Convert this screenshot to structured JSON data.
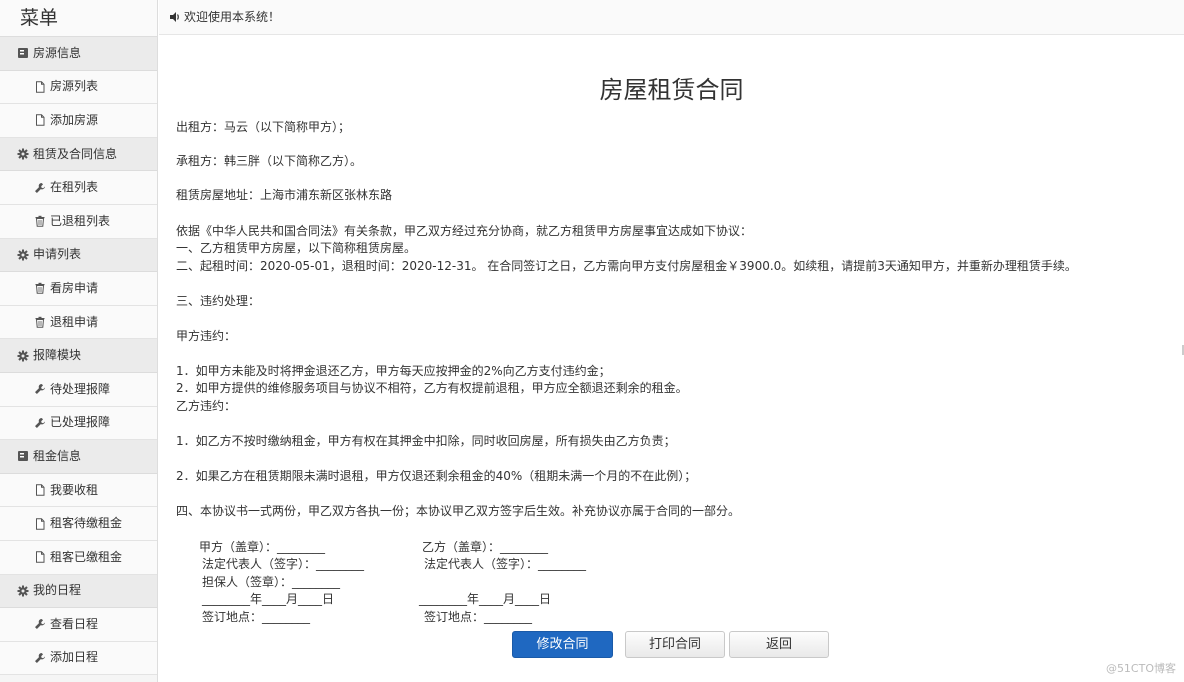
{
  "sidebar": {
    "title": "菜单",
    "groups": [
      {
        "label": "房源信息",
        "icon": "book-icon",
        "items": [
          {
            "label": "房源列表",
            "icon": "file-icon"
          },
          {
            "label": "添加房源",
            "icon": "file-icon"
          }
        ]
      },
      {
        "label": "租赁及合同信息",
        "icon": "gear-icon",
        "items": [
          {
            "label": "在租列表",
            "icon": "wrench-icon"
          },
          {
            "label": "已退租列表",
            "icon": "trash-icon"
          }
        ]
      },
      {
        "label": "申请列表",
        "icon": "gear-icon",
        "items": [
          {
            "label": "看房申请",
            "icon": "trash-icon"
          },
          {
            "label": "退租申请",
            "icon": "trash-icon"
          }
        ]
      },
      {
        "label": "报障模块",
        "icon": "gear-icon",
        "items": [
          {
            "label": "待处理报障",
            "icon": "wrench-icon"
          },
          {
            "label": "已处理报障",
            "icon": "wrench-icon"
          }
        ]
      },
      {
        "label": "租金信息",
        "icon": "book-icon",
        "items": [
          {
            "label": "我要收租",
            "icon": "file-icon"
          },
          {
            "label": "租客待缴租金",
            "icon": "file-icon"
          },
          {
            "label": "租客已缴租金",
            "icon": "file-icon"
          }
        ]
      },
      {
        "label": "我的日程",
        "icon": "gear-icon",
        "items": [
          {
            "label": "查看日程",
            "icon": "wrench-icon"
          },
          {
            "label": "添加日程",
            "icon": "wrench-icon"
          }
        ]
      }
    ]
  },
  "topbar": {
    "welcome": "欢迎使用本系统！",
    "icon": "volume-icon"
  },
  "contract": {
    "title": "房屋租赁合同",
    "lessor": "出租方：马云（以下简称甲方）；",
    "lessee": "承租方：韩三胖（以下简称乙方）。",
    "address": "租赁房屋地址：上海市浦东新区张林东路",
    "intro": "依据《中华人民共和国合同法》有关条款，甲乙双方经过充分协商，就乙方租赁甲方房屋事宜达成如下协议：",
    "clause1": "一、乙方租赁甲方房屋，以下简称租赁房屋。",
    "clause2": "二、起租时间：2020-05-01，退租时间：2020-12-31。 在合同签订之日，乙方需向甲方支付房屋租金￥3900.0。如续租，请提前3天通知甲方，并重新办理租赁手续。",
    "clause3": "三、违约处理：",
    "partyA_breach": "甲方违约：",
    "a1": "1．如甲方未能及时将押金退还乙方，甲方每天应按押金的2%向乙方支付违约金；",
    "a2": "2．如甲方提供的维修服务项目与协议不相符，乙方有权提前退租，甲方应全额退还剩余的租金。",
    "partyB_breach": "乙方违约：",
    "b1": "1．如乙方不按时缴纳租金，甲方有权在其押金中扣除，同时收回房屋，所有损失由乙方负责；",
    "b2": "2．如果乙方在租赁期限未满时退租，甲方仅退还剩余租金的40%（租期未满一个月的不在此例）；",
    "clause4": "四、本协议书一式两份，甲乙双方各执一份；本协议甲乙双方签字后生效。补充协议亦属于合同的一部分。"
  },
  "signatures": {
    "left": {
      "seal": "甲方（盖章）：________",
      "rep": "法定代表人（签字）：________",
      "guarantor": "担保人（签章）：________",
      "date": "________年____月____日",
      "place": "签订地点：________"
    },
    "right": {
      "seal": "乙方（盖章）：________",
      "rep": "法定代表人（签字）：________",
      "date": "________年____月____日",
      "place": "签订地点：________"
    }
  },
  "buttons": {
    "edit": "修改合同",
    "print": "打印合同",
    "back": "返回"
  },
  "watermark": "@51CTO博客",
  "colors": {
    "primary": "#1f68c1",
    "sidebar_bg": "#f5f5f5",
    "group_bg": "#ebebeb"
  }
}
